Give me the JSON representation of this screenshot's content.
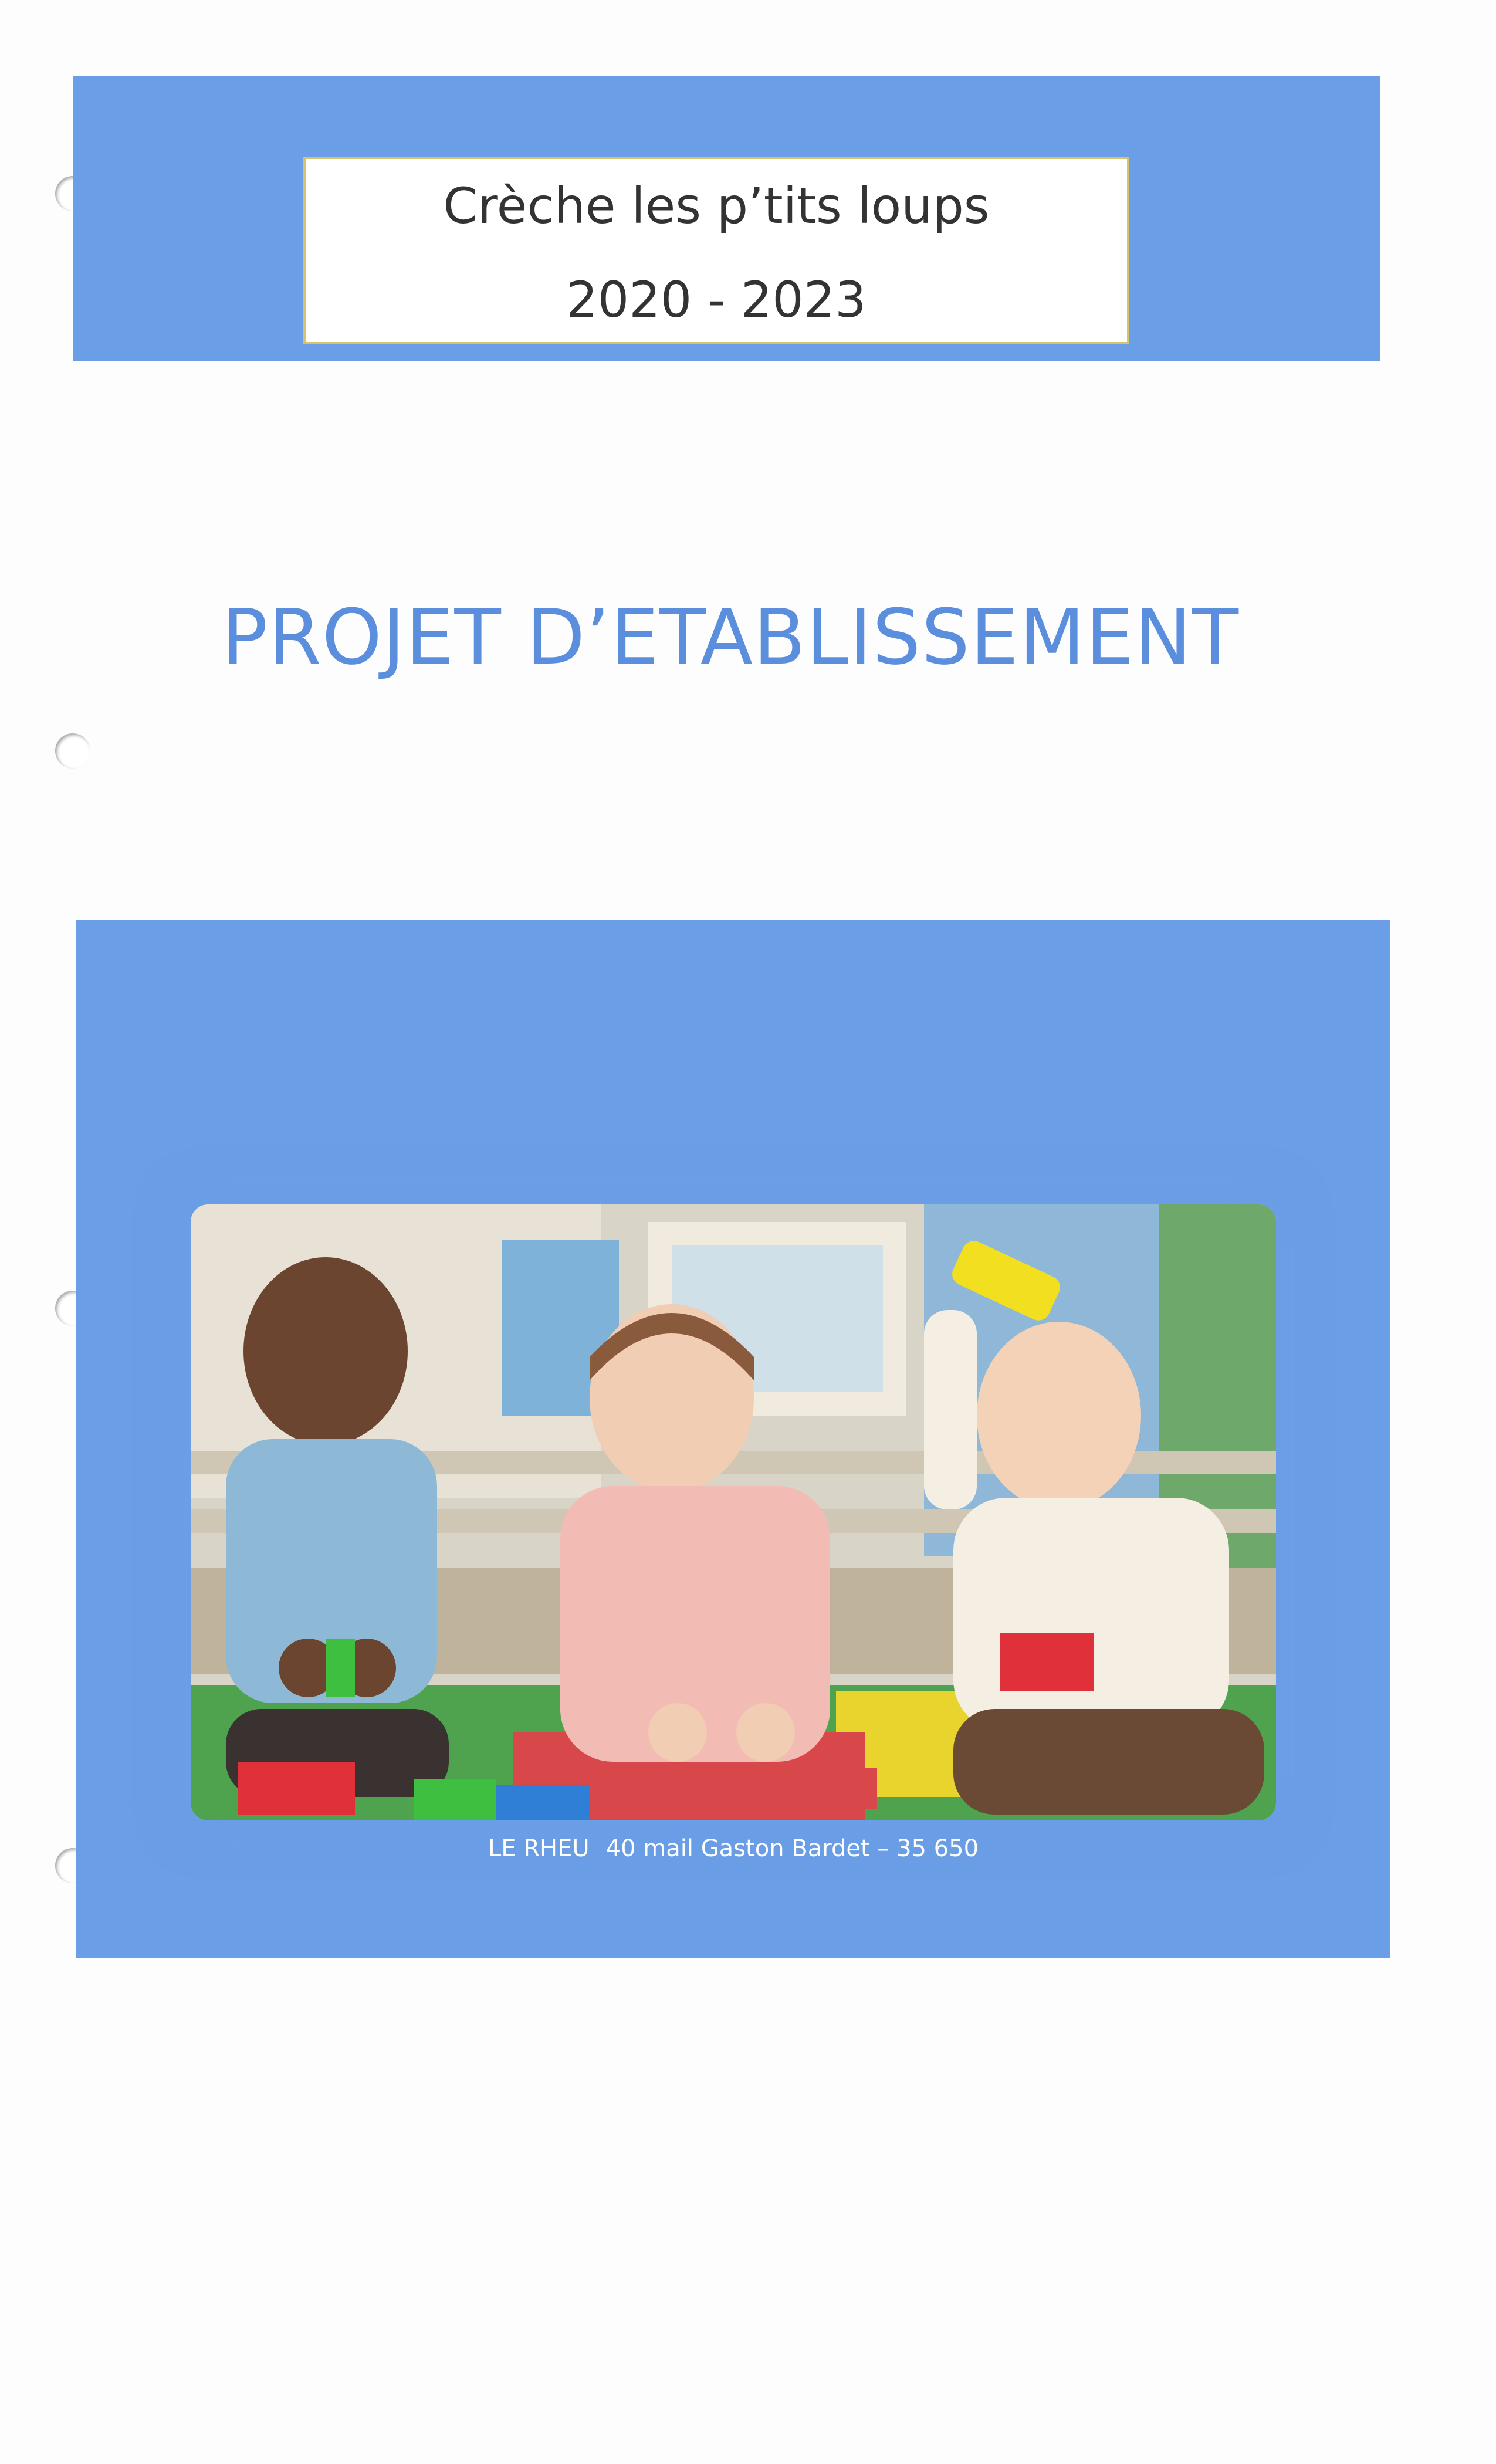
{
  "header": {
    "title": "Crèche les p’tits loups",
    "years": "2020 - 2023"
  },
  "main": {
    "heading": "PROJET D’ETABLISSEMENT"
  },
  "footer": {
    "city": "LE RHEU",
    "address": "40 mail Gaston Bardet – 35 650"
  },
  "colors": {
    "band_blue": "#6a9ee6",
    "heading_blue": "#5b8fdd",
    "title_border": "#d9c36a"
  },
  "photo": {
    "subject": "three-toddlers-playing-with-building-blocks"
  }
}
